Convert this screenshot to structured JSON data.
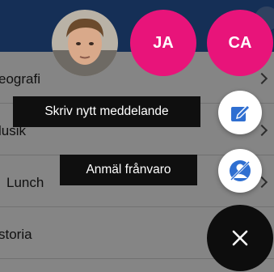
{
  "list": {
    "items": [
      {
        "label": "eografi"
      },
      {
        "label": "lusik"
      },
      {
        "label": "Lunch"
      },
      {
        "label": "storia"
      }
    ]
  },
  "fab_menu": {
    "avatars": [
      {
        "initials": "JA",
        "color": "#e8147a"
      },
      {
        "initials": "CA",
        "color": "#e8147a"
      }
    ],
    "actions": [
      {
        "label": "Skriv nytt meddelande",
        "icon": "compose-icon"
      },
      {
        "label": "Anmäl frånvaro",
        "icon": "absence-icon"
      }
    ],
    "close_icon": "close-icon"
  },
  "colors": {
    "header": "#2a5aa6",
    "accent": "#e8147a",
    "action_icon": "#2f6fd1"
  }
}
